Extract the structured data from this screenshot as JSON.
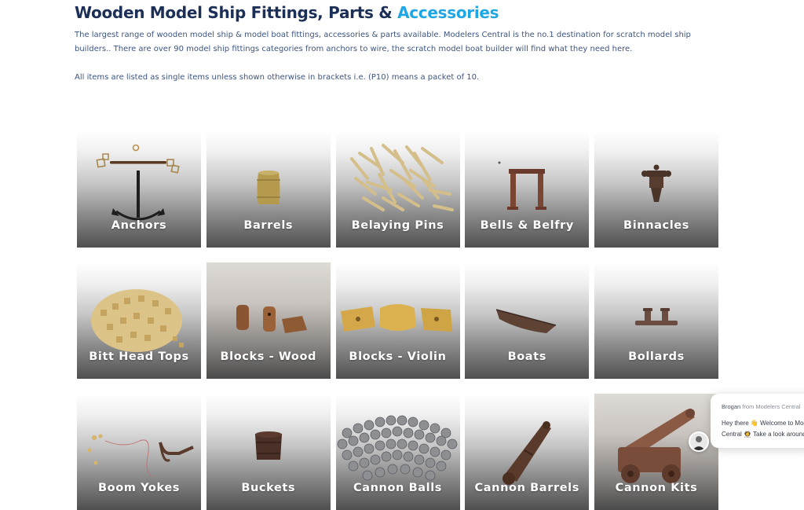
{
  "header": {
    "title_main": "Wooden Model Ship Fittings, Parts &",
    "title_accent": "Accessories",
    "intro": "The largest range of wooden model ship & model boat fittings, accessories & parts available. Modelers Central is the no.1 destination for scratch model ship builders.. There are over 90 model ship fittings categories from anchors to wire, the scratch model boat builder will find what they need here.",
    "note": "All items are listed as single items unless shown otherwise in brackets i.e. (P10) means a packet of 10."
  },
  "categories": [
    {
      "label": "Anchors"
    },
    {
      "label": "Barrels"
    },
    {
      "label": "Belaying Pins"
    },
    {
      "label": "Bells & Belfry"
    },
    {
      "label": "Binnacles"
    },
    {
      "label": "Bitt Head Tops"
    },
    {
      "label": "Blocks - Wood"
    },
    {
      "label": "Blocks - Violin"
    },
    {
      "label": "Boats"
    },
    {
      "label": "Bollards"
    },
    {
      "label": "Boom Yokes"
    },
    {
      "label": "Buckets"
    },
    {
      "label": "Cannon Balls"
    },
    {
      "label": "Cannon Barrels"
    },
    {
      "label": "Cannon Kits"
    }
  ],
  "chat": {
    "agent_name": "Brogan",
    "from_text": "from Modelers Central",
    "message_line1": "Hey there 👋 Welcome to Modelers",
    "message_line2": "Central 👩‍🚀 Take a look around"
  },
  "colors": {
    "title": "#1c2f57",
    "accent": "#1ea7e4",
    "body_text": "#3d5580"
  }
}
